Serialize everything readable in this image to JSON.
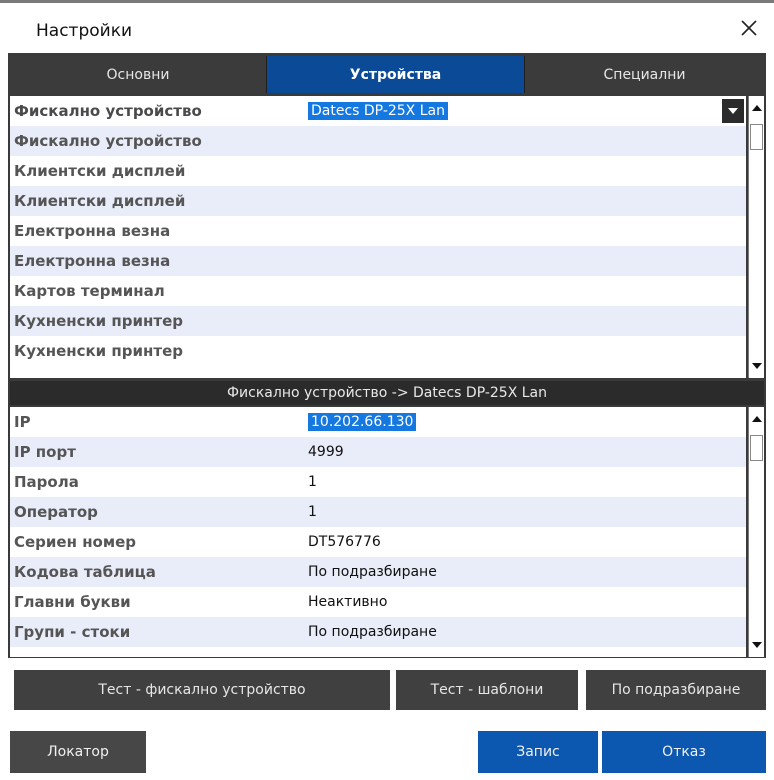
{
  "window": {
    "title": "Настройки"
  },
  "tabs": [
    {
      "label": "Основни"
    },
    {
      "label": "Устройства"
    },
    {
      "label": "Специални"
    }
  ],
  "devices": {
    "selected_value": "Datecs DP-25X Lan",
    "rows": [
      "Фискално устройство",
      "Фискално устройство",
      "Клиентски дисплей",
      "Клиентски дисплей",
      "Електронна везна",
      "Електронна везна",
      "Картов терминал",
      "Кухненски принтер",
      "Кухненски принтер"
    ]
  },
  "section_title": "Фискално устройство -> Datecs DP-25X Lan",
  "properties": [
    {
      "label": "IP",
      "value": "10.202.66.130"
    },
    {
      "label": "IP порт",
      "value": "4999"
    },
    {
      "label": "Парола",
      "value": "1"
    },
    {
      "label": "Оператор",
      "value": "1"
    },
    {
      "label": "Сериен номер",
      "value": "DT576776"
    },
    {
      "label": "Кодова таблица",
      "value": "По подразбиране"
    },
    {
      "label": "Главни букви",
      "value": "Неактивно"
    },
    {
      "label": "Групи - стоки",
      "value": "По подразбиране"
    }
  ],
  "actions": {
    "test_fiscal": "Тест - фискално устройство",
    "test_templates": "Тест - шаблони",
    "default": "По подразбиране"
  },
  "footer": {
    "locator": "Локатор",
    "save": "Запис",
    "cancel": "Отказ"
  }
}
